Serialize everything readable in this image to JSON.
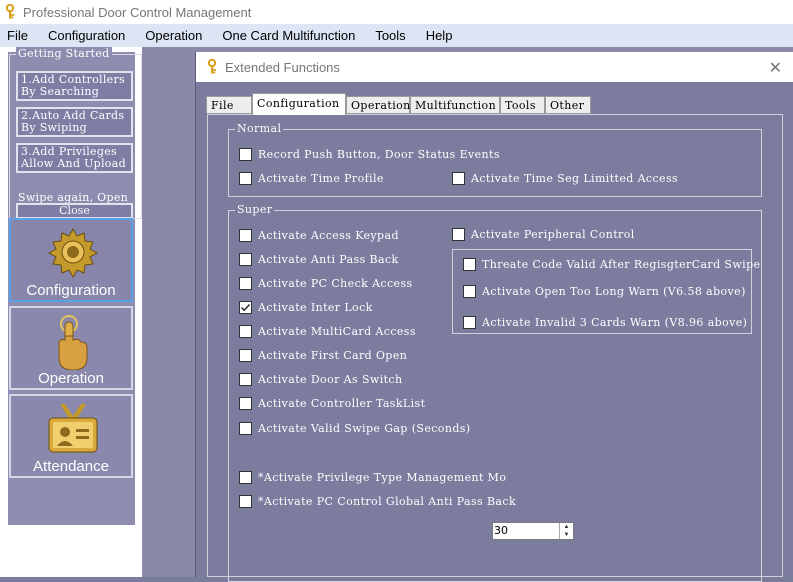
{
  "app": {
    "title": "Professional Door Control Management"
  },
  "menu": [
    "File",
    "Configuration",
    "Operation",
    "One Card Multifunction",
    "Tools",
    "Help"
  ],
  "getting_started": {
    "title": "Getting Started",
    "steps": [
      {
        "line1": "1.Add Controllers",
        "line2": "By Searching"
      },
      {
        "line1": "2.Auto Add Cards",
        "line2": "By Swiping"
      },
      {
        "line1": "3.Add Privileges",
        "line2": "Allow And Upload"
      }
    ],
    "swipe_text": "Swipe again, Open",
    "close_label": "Close"
  },
  "nav": [
    {
      "label": "Configuration",
      "icon": "gear-icon",
      "active": true
    },
    {
      "label": "Operation",
      "icon": "hand-pointer-icon",
      "active": false
    },
    {
      "label": "Attendance",
      "icon": "id-badge-icon",
      "active": false
    }
  ],
  "dialog": {
    "title": "Extended Functions",
    "tabs": [
      "File",
      "Configuration",
      "Operation",
      "Multifunction",
      "Tools",
      "Other"
    ],
    "active_tab": "Configuration",
    "normal": {
      "title": "Normal",
      "items": [
        {
          "label": "Record Push Button, Door Status Events",
          "checked": false
        },
        {
          "label": "Activate Time Profile",
          "checked": false
        },
        {
          "label": "Activate Time Seg Limitted Access",
          "checked": false
        }
      ]
    },
    "super": {
      "title": "Super",
      "left_items": [
        {
          "label": "Activate Access Keypad",
          "checked": false
        },
        {
          "label": "Activate Anti Pass Back",
          "checked": false
        },
        {
          "label": "Activate PC Check Access",
          "checked": false
        },
        {
          "label": "Activate Inter Lock",
          "checked": true
        },
        {
          "label": "Activate MultiCard Access",
          "checked": false
        },
        {
          "label": "Activate First Card Open",
          "checked": false
        },
        {
          "label": "Activate Door As Switch",
          "checked": false
        },
        {
          "label": "Activate Controller TaskList",
          "checked": false
        },
        {
          "label": "Activate Valid Swipe Gap (Seconds)",
          "checked": false
        }
      ],
      "peripheral": {
        "label": "Activate Peripheral Control",
        "checked": false
      },
      "peripheral_items": [
        {
          "label": "Threate Code Valid After RegisgterCard Swipe",
          "checked": false
        },
        {
          "label": "Activate Open Too Long Warn (V6.58 above)",
          "checked": false
        },
        {
          "label": "Activate Invalid 3 Cards  Warn (V8.96 above)",
          "checked": false
        }
      ],
      "privilege_type": {
        "label": "*Activate Privilege Type Management Mo",
        "checked": false
      },
      "privilege_value": "30",
      "global_anti": {
        "label": "*Activate PC Control Global Anti Pass Back",
        "checked": false
      }
    }
  }
}
